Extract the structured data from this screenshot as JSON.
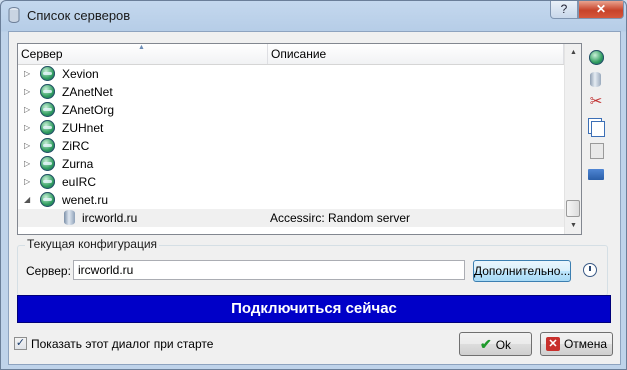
{
  "window": {
    "title": "Список серверов",
    "help_label": "?",
    "close_label": "✕"
  },
  "list": {
    "columns": [
      "Сервер",
      "Описание"
    ],
    "networks": [
      {
        "name": "Xevion",
        "state": "collapsed"
      },
      {
        "name": "ZAnetNet",
        "state": "collapsed"
      },
      {
        "name": "ZAnetOrg",
        "state": "collapsed"
      },
      {
        "name": "ZUHnet",
        "state": "collapsed"
      },
      {
        "name": "ZiRC",
        "state": "collapsed"
      },
      {
        "name": "Zurna",
        "state": "collapsed"
      },
      {
        "name": "euIRC",
        "state": "collapsed"
      },
      {
        "name": "wenet.ru",
        "state": "expanded"
      }
    ],
    "selected_server": {
      "name": "ircworld.ru",
      "description": "Accessirc: Random server"
    },
    "expander_collapsed": "▷",
    "expander_expanded": "◢"
  },
  "sidebar_icons": [
    "globe-icon",
    "server-icon",
    "scissors-icon",
    "copy-icon",
    "paste-icon",
    "folder-icon"
  ],
  "config": {
    "group_title": "Текущая конфигурация",
    "server_label": "Сервер:",
    "server_value": "ircworld.ru",
    "advanced_button": "Дополнительно..."
  },
  "connect_button": "Подключиться сейчас",
  "footer": {
    "show_on_start_label": "Показать этот диалог при старте",
    "show_on_start_checked": true,
    "ok_button": "Ok",
    "cancel_button": "Отмена"
  },
  "colors": {
    "connect_bg": "#0000c8",
    "close_button": "#c7432a"
  }
}
